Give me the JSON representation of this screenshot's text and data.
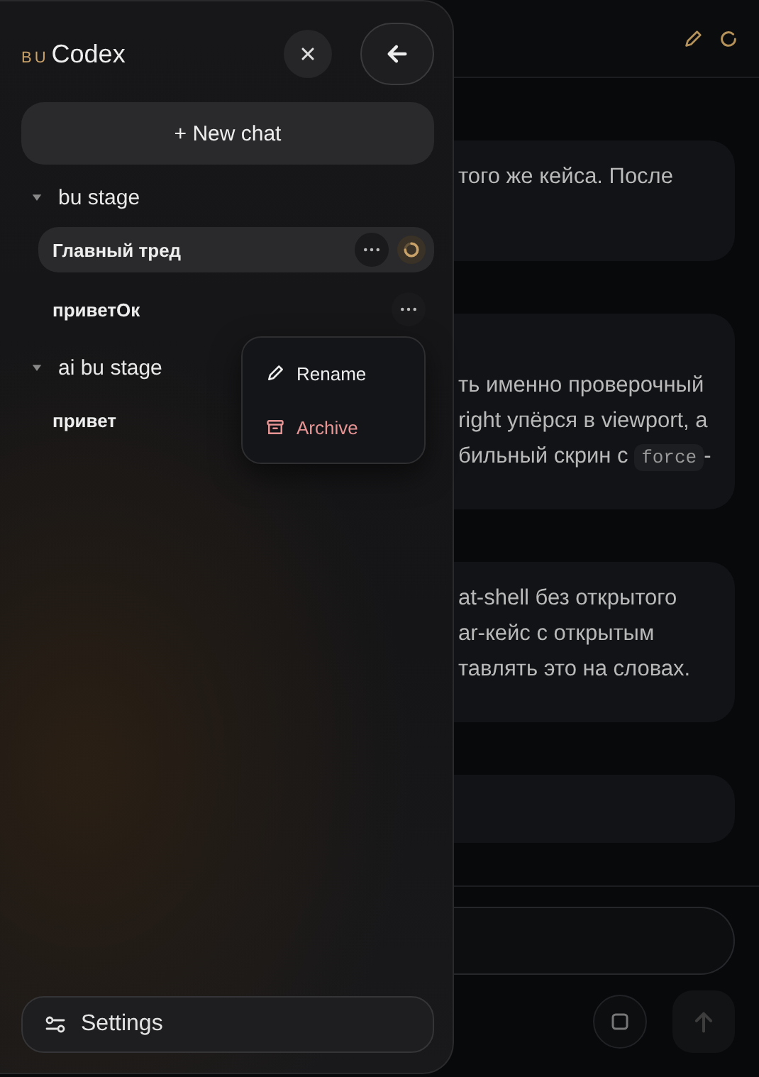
{
  "messages": [
    {
      "kind": "text",
      "lines": [
        [
          {
            "kind": "text",
            "text": "того же кейса. После"
          }
        ]
      ]
    },
    {
      "kind": "text",
      "lines": [
        [
          {
            "kind": "text",
            "text": "ть именно проверочный"
          }
        ],
        [
          {
            "kind": "text",
            "text": "right упёрся в viewport, а"
          }
        ],
        [
          {
            "kind": "text",
            "text": "бильный скрин с "
          },
          {
            "kind": "code",
            "text": "force"
          },
          {
            "kind": "text",
            "text": "-"
          }
        ]
      ]
    },
    {
      "kind": "text",
      "lines": [
        [
          {
            "kind": "text",
            "text": "at-shell без открытого"
          }
        ],
        [
          {
            "kind": "text",
            "text": "ar-кейс с открытым"
          }
        ],
        [
          {
            "kind": "text",
            "text": "тавлять это на словах."
          }
        ]
      ]
    },
    {
      "kind": "thinking"
    }
  ],
  "sidebar": {
    "logo_mark": "BU",
    "logo_text": "Codex",
    "new_chat": "+ New chat",
    "settings": "Settings",
    "groups": [
      {
        "name": "bu stage",
        "expanded": true,
        "chats": [
          {
            "title": "Главный тред",
            "selected": true,
            "busy": true,
            "menu_open": false
          },
          {
            "title": "приветОк",
            "selected": false,
            "busy": false,
            "menu_open": true
          }
        ]
      },
      {
        "name": "ai bu stage",
        "expanded": true,
        "chats": [
          {
            "title": "привет",
            "selected": false,
            "busy": false,
            "menu_open": false
          }
        ]
      }
    ]
  },
  "context_menu": {
    "items": [
      {
        "kind": "rename",
        "label": "Rename"
      },
      {
        "kind": "archive",
        "label": "Archive"
      }
    ]
  }
}
